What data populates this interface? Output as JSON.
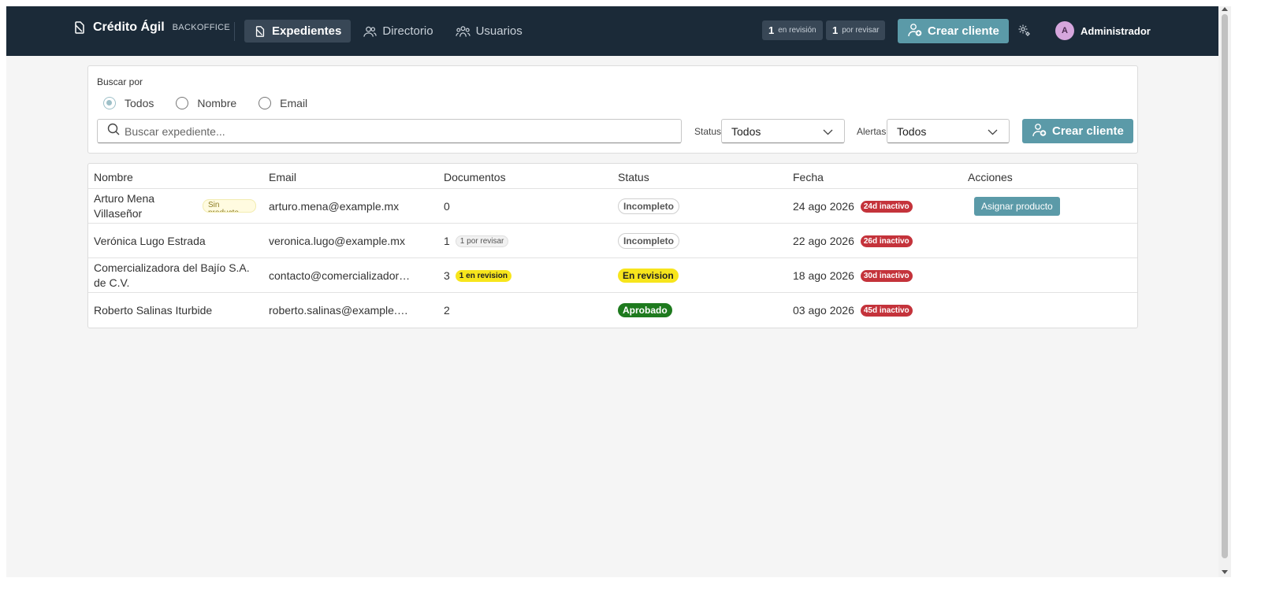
{
  "header": {
    "brand_name": "Crédito Ágil",
    "brand_sub": "BACKOFFICE",
    "nav": [
      {
        "label": "Expedientes",
        "icon": "document-icon",
        "active": true
      },
      {
        "label": "Directorio",
        "icon": "users-icon",
        "active": false
      },
      {
        "label": "Usuarios",
        "icon": "user-group-icon",
        "active": false
      }
    ],
    "counters": [
      {
        "count": "1",
        "label": "en revisión"
      },
      {
        "count": "1",
        "label": "por revisar"
      }
    ],
    "create_label": "Crear cliente",
    "settings_icon": "gear-icon",
    "user": {
      "initial": "A",
      "name": "Administrador"
    }
  },
  "search": {
    "search_by_label": "Buscar por",
    "options": [
      "Todos",
      "Nombre",
      "Email"
    ],
    "selected": "Todos",
    "placeholder": "Buscar expediente...",
    "status_label": "Status",
    "status_value": "Todos",
    "alerts_label": "Alertas",
    "alerts_value": "Todos",
    "create_label": "Crear cliente"
  },
  "table": {
    "columns": [
      "Nombre",
      "Email",
      "Documentos",
      "Status",
      "Fecha",
      "Acciones"
    ],
    "rows": [
      {
        "name": "Arturo Mena Villaseñor",
        "name_badge": "Sin producto",
        "email": "arturo.mena@example.mx",
        "docs": "0",
        "docs_badge": "",
        "status": "Incompleto",
        "date": "24 ago 2026",
        "inactive": "24d inactivo",
        "action": "Asignar producto"
      },
      {
        "name": "Verónica Lugo Estrada",
        "name_badge": "",
        "email": "veronica.lugo@example.mx",
        "docs": "1",
        "docs_badge": "1 por revisar",
        "status": "Incompleto",
        "date": "22 ago 2026",
        "inactive": "26d inactivo",
        "action": ""
      },
      {
        "name": "Comercializadora del Bajío S.A. de C.V.",
        "name_badge": "",
        "email": "contacto@comercializadora.mx",
        "docs": "3",
        "docs_badge": "1 en revision",
        "status": "En revision",
        "date": "18 ago 2026",
        "inactive": "30d inactivo",
        "action": ""
      },
      {
        "name": "Roberto Salinas Iturbide",
        "name_badge": "",
        "email": "roberto.salinas@example.mx",
        "docs": "2",
        "docs_badge": "",
        "status": "Aprobado",
        "date": "03 ago 2026",
        "inactive": "45d inactivo",
        "action": ""
      }
    ]
  },
  "colors": {
    "header_bg": "#1b2a38",
    "accent": "#5b9aa8",
    "status_review": "#f7e51c",
    "status_approved": "#1e7a1e",
    "inactive_badge": "#c4333b"
  }
}
